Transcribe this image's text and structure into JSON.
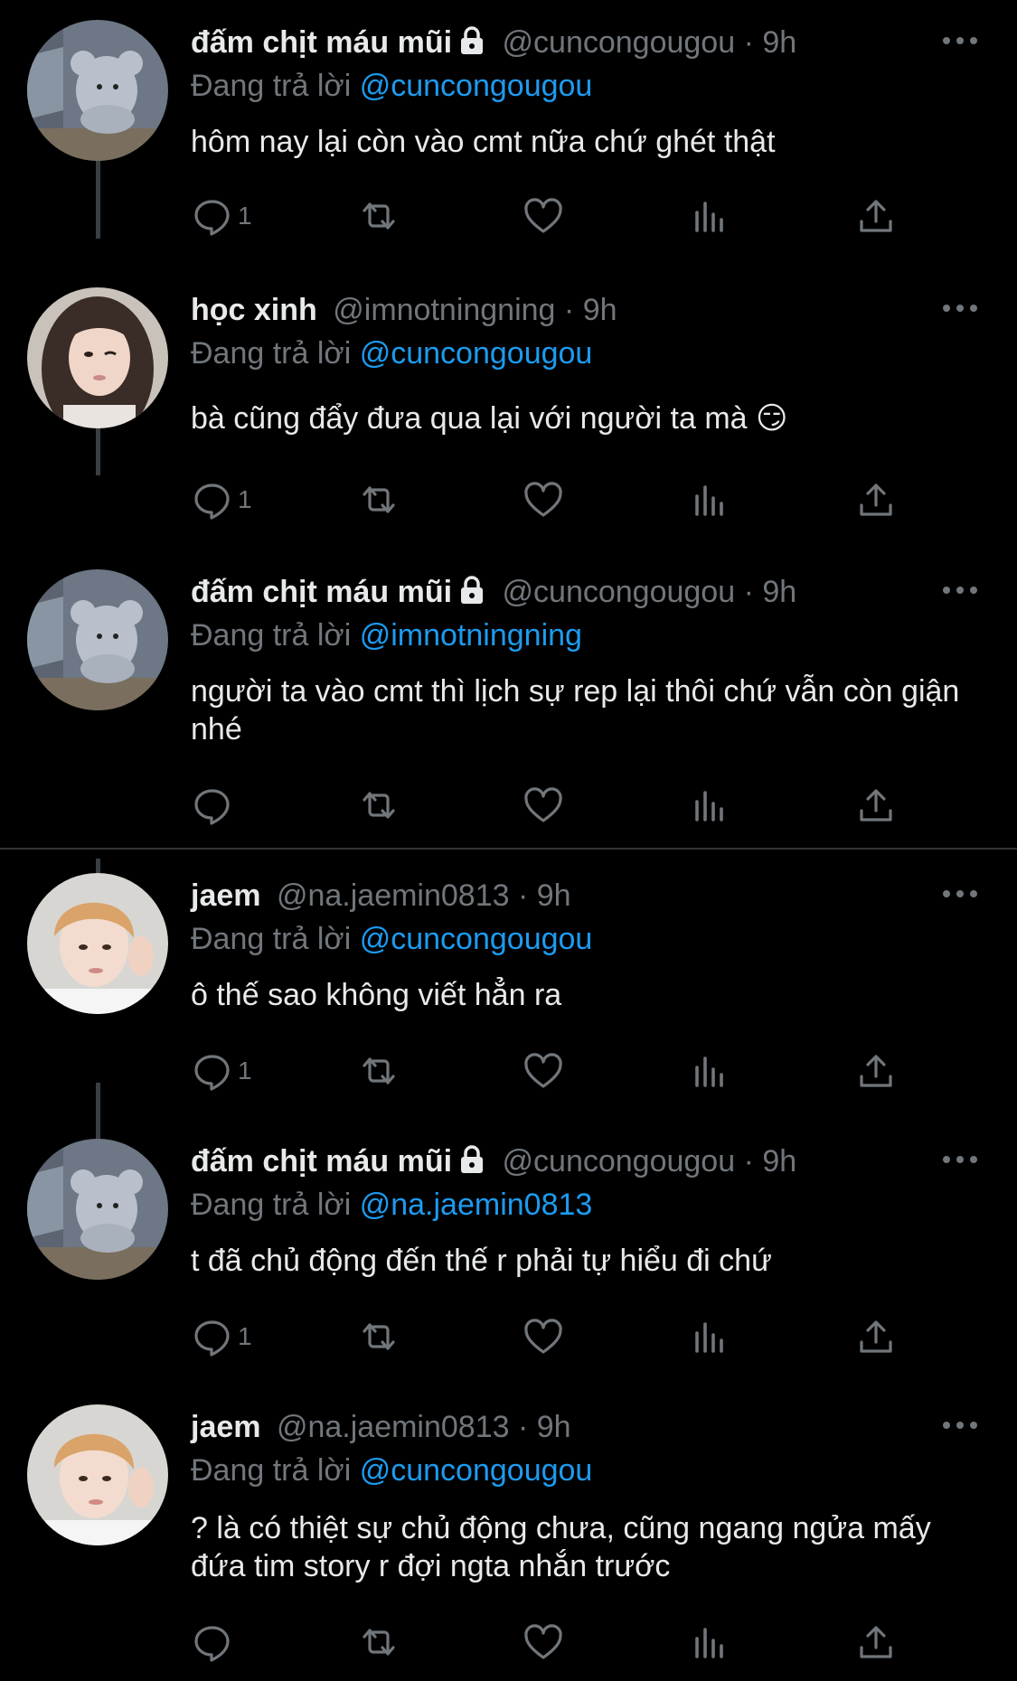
{
  "reply_prefix": "Đang trả lời",
  "tweets": [
    {
      "display_name": "đấm chịt máu mũi",
      "handle": "@cuncongougou",
      "separator": "·",
      "time": "9h",
      "reply_to": "@cuncongougou",
      "text": "hôm nay lại còn vào cmt nữa chứ ghét thật",
      "reply_count": "1",
      "locked": true
    },
    {
      "display_name": "học xinh",
      "handle": "@imnotningning",
      "separator": "·",
      "time": "9h",
      "reply_to": "@cuncongougou",
      "text": "bà cũng đẩy đưa qua lại với người ta mà 😏",
      "reply_count": "1",
      "locked": false
    },
    {
      "display_name": "đấm chịt máu mũi",
      "handle": "@cuncongougou",
      "separator": "·",
      "time": "9h",
      "reply_to": "@imnotningning",
      "text": "người ta vào cmt thì lịch sự rep lại thôi chứ vẫn còn giận nhé",
      "reply_count": "",
      "locked": true
    },
    {
      "display_name": "jaem",
      "handle": "@na.jaemin0813",
      "separator": "·",
      "time": "9h",
      "reply_to": "@cuncongougou",
      "text": "ô thế sao không viết hẳn ra",
      "reply_count": "1",
      "locked": false
    },
    {
      "display_name": "đấm chịt máu mũi",
      "handle": "@cuncongougou",
      "separator": "·",
      "time": "9h",
      "reply_to": "@na.jaemin0813",
      "text": "t đã chủ động đến thế r phải tự hiểu đi chứ",
      "reply_count": "1",
      "locked": true
    },
    {
      "display_name": "jaem",
      "handle": "@na.jaemin0813",
      "separator": "·",
      "time": "9h",
      "reply_to": "@cuncongougou",
      "text": "? là có thiệt sự chủ động chưa, cũng ngang ngửa mấy đứa tim story r đợi ngta nhắn trước",
      "reply_count": "",
      "locked": false
    }
  ],
  "colors": {
    "background": "#000000",
    "text": "#e7e9ea",
    "secondary": "#71767b",
    "link": "#1d9bf0"
  }
}
